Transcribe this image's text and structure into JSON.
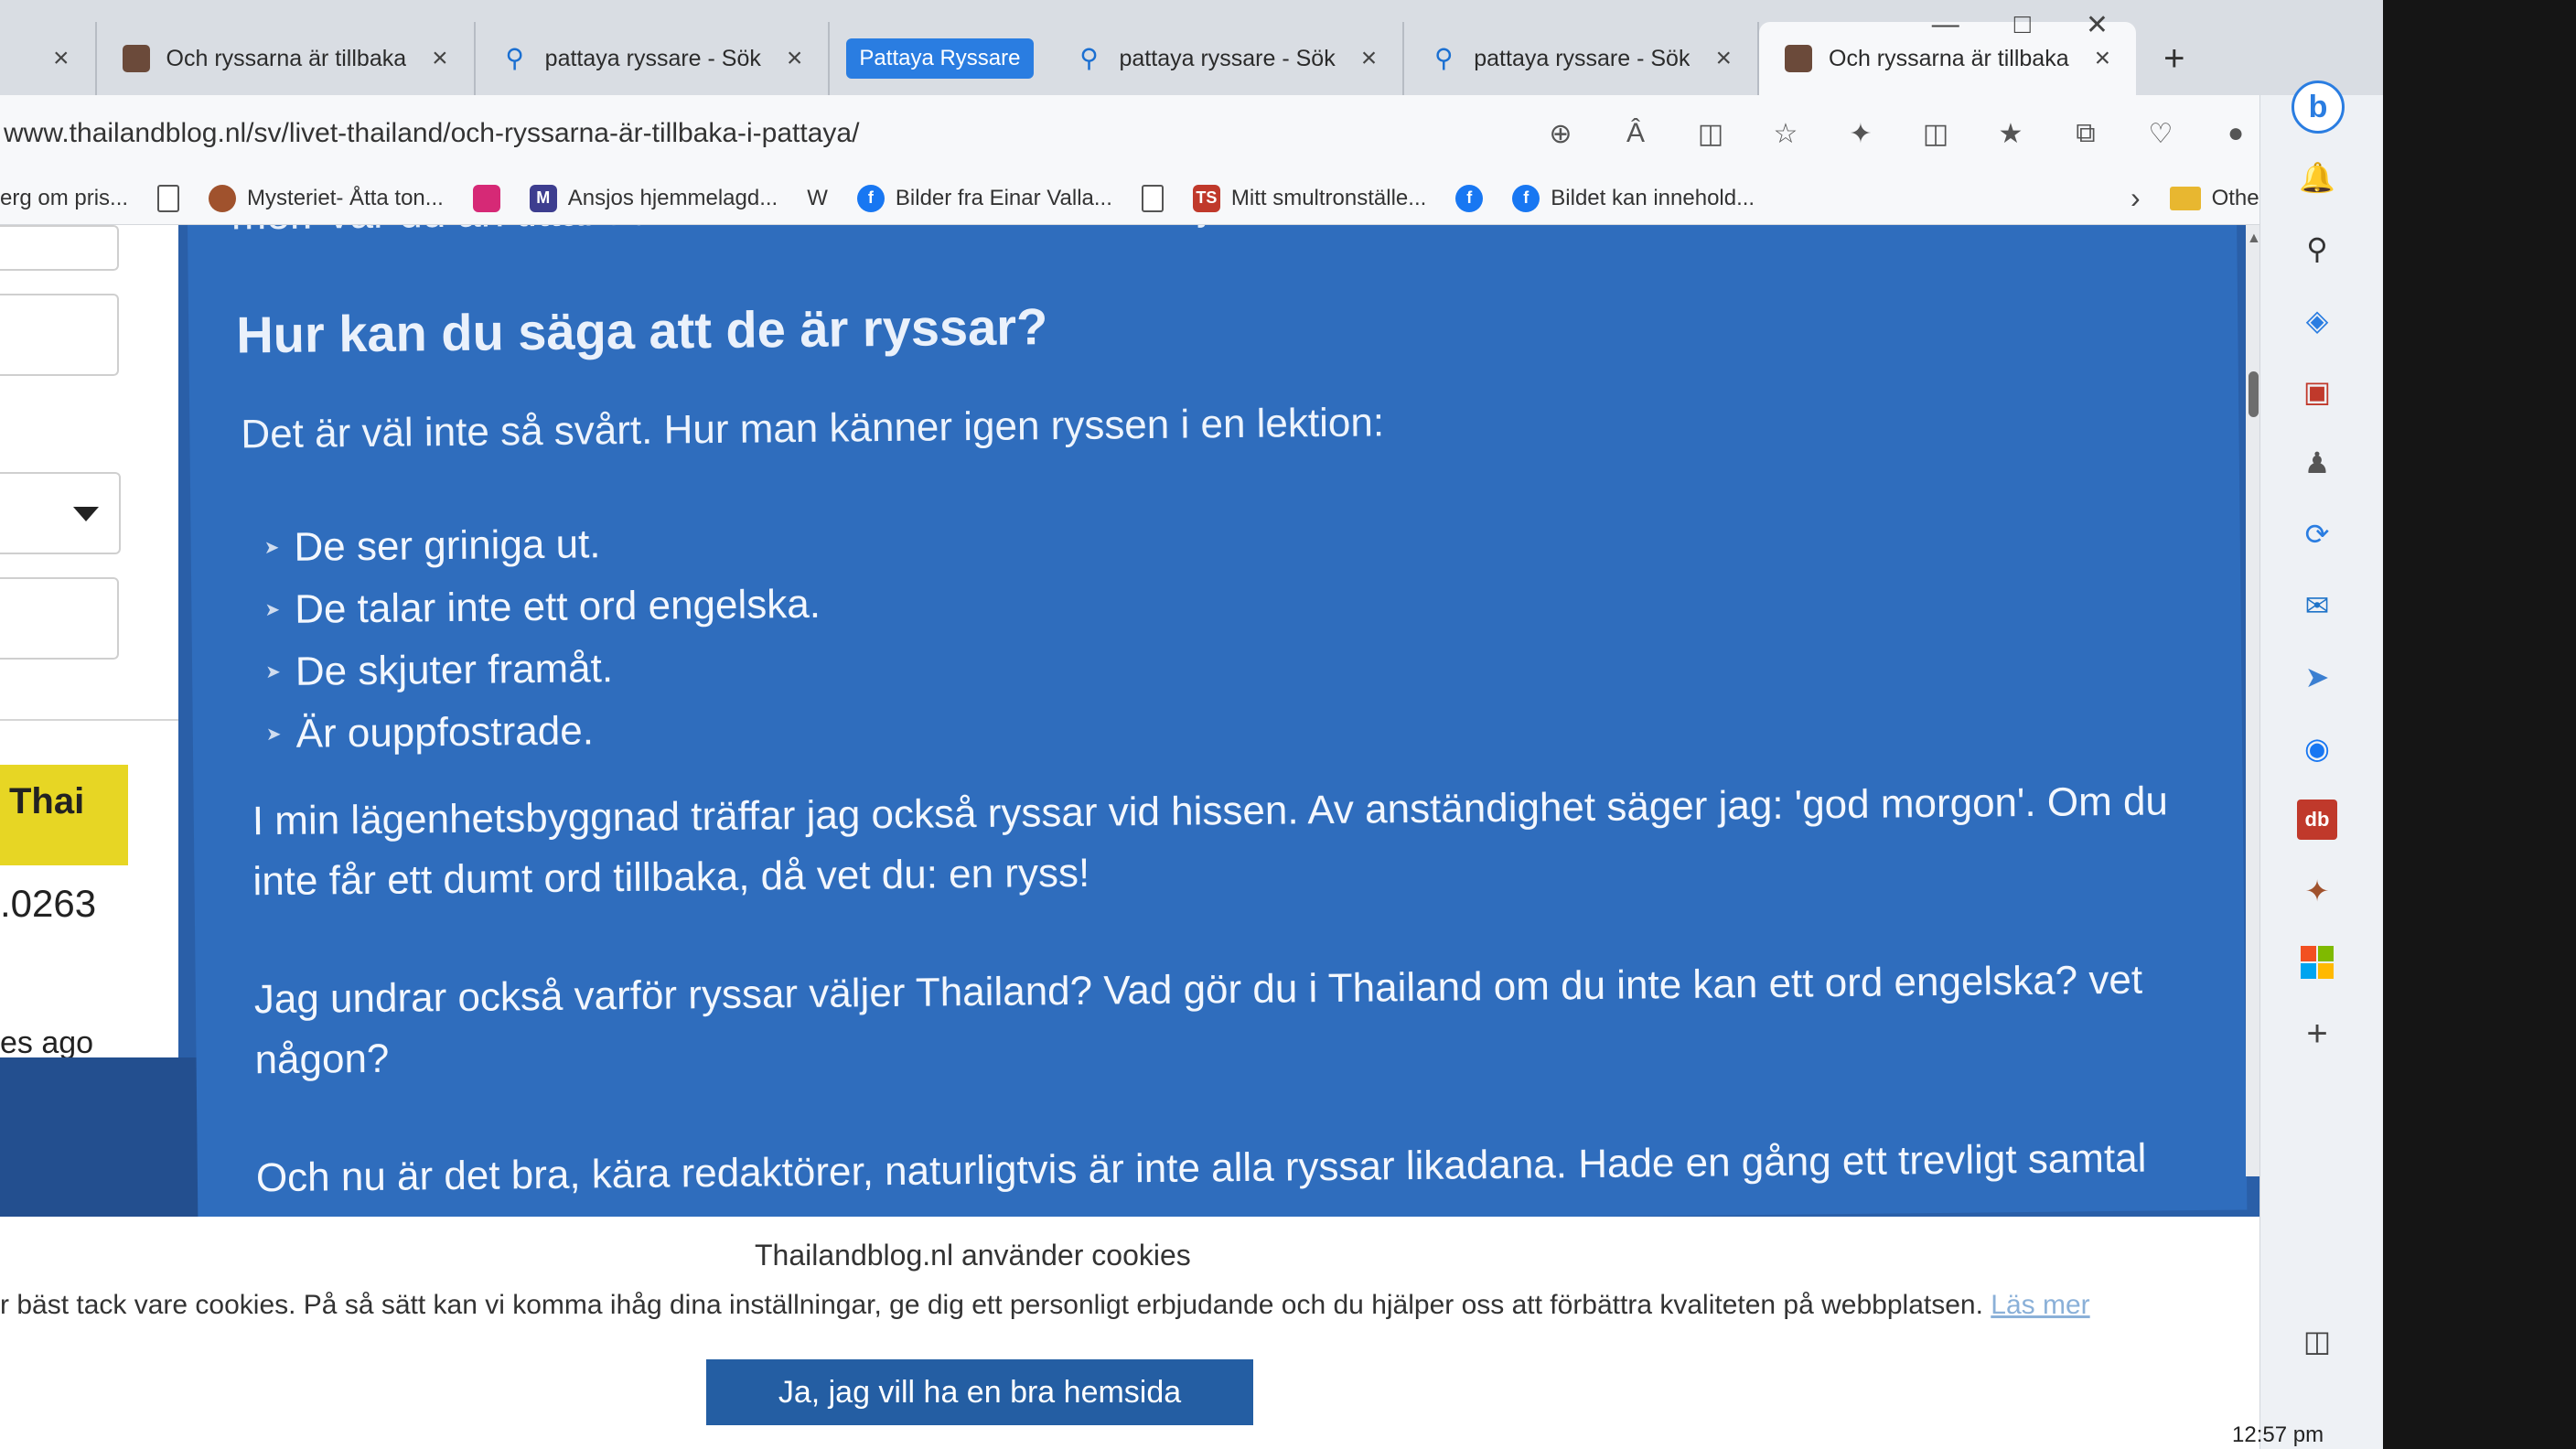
{
  "tabs": [
    {
      "label": "Och ryssarna är tillbaka",
      "type": "page"
    },
    {
      "label": "pattaya ryssare - Sök",
      "type": "search"
    },
    {
      "label": "pattaya ryssare - Sök",
      "type": "search"
    },
    {
      "label": "pattaya ryssare - Sök",
      "type": "search"
    },
    {
      "label": "Och ryssarna är tillbaka",
      "type": "page"
    }
  ],
  "tab_group_label": "Pattaya Ryssare",
  "address": {
    "url": "www.thailandblog.nl/sv/livet-thailand/och-ryssarna-är-tillbaka-i-pattaya/"
  },
  "favorites": [
    {
      "label": "erg om pris...",
      "icon": "none"
    },
    {
      "label": "",
      "icon": "doc"
    },
    {
      "label": "Mysteriet- Åtta ton...",
      "icon": "bird"
    },
    {
      "label": "",
      "icon": "instagram"
    },
    {
      "label": "Ansjos hjemmelagd...",
      "icon": "m"
    },
    {
      "label": "",
      "icon": "wikipedia"
    },
    {
      "label": "Bilder fra Einar Valla...",
      "icon": "facebook"
    },
    {
      "label": "",
      "icon": "doc"
    },
    {
      "label": "Mitt smultronställe...",
      "icon": "ts"
    },
    {
      "label": "",
      "icon": "facebook"
    },
    {
      "label": "Bildet kan innehold...",
      "icon": "facebook"
    }
  ],
  "other_favorites": "Other favorites",
  "left_widget": {
    "badge": "Thai",
    "rate": ".0263",
    "ago": "es ago"
  },
  "article": {
    "cut_line": "mer. Var du än tittar kan du inte missa Boris och Katja.",
    "heading": "Hur kan du säga att de är ryssar?",
    "lead": "Det är väl inte så svårt. Hur man känner igen ryssen i en lektion:",
    "bullets": [
      "De ser griniga ut.",
      "De talar inte ett ord engelska.",
      "De skjuter framåt.",
      "Är ouppfostrade."
    ],
    "para1": "I min lägenhetsbyggnad träffar jag också ryssar vid hissen. Av anständighet säger jag: 'god morgon'. Om du inte får ett dumt ord tillbaka, då vet du: en ryss!",
    "para2": "Jag undrar också varför ryssar väljer Thailand? Vad gör du i Thailand om du inte kan ett ord engelska? vet någon?",
    "para3": "Och nu är det bra, kära redaktörer, naturligtvis är inte alla ryssar likadana. Hade en gång ett trevligt samtal"
  },
  "cookie": {
    "title": "Thailandblog.nl använder cookies",
    "text": "r bäst tack vare cookies. På så sätt kan vi komma ihåg dina inställningar, ge dig ett personligt erbjudande och du hjälper oss att förbättra kvaliteten på webbplatsen.",
    "link": "Läs mer",
    "button": "Ja, jag vill ha en bra hemsida"
  },
  "clock": "12:57 pm",
  "colors": {
    "article_bg": "#2f6dbd",
    "badge": "#e7d624",
    "accent": "#2a7de1",
    "cookie_button": "#245ea3"
  }
}
